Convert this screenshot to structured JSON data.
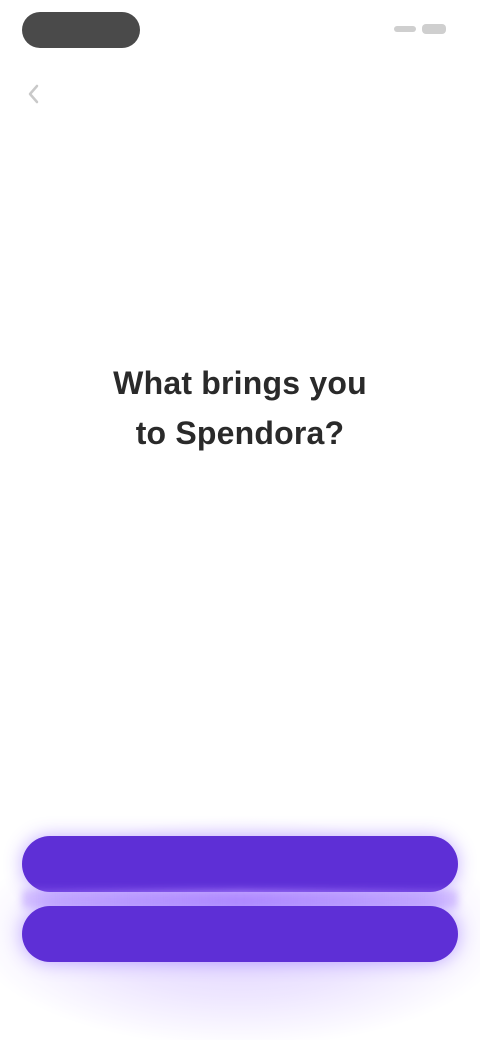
{
  "headline": {
    "line1": "What brings you",
    "line2": "to Spendora?"
  },
  "buttons": {
    "primary_label": "",
    "secondary_label": ""
  },
  "icons": {
    "back": "chevron-left-icon",
    "status": "status-icons"
  },
  "colors": {
    "background": "#ffffff",
    "button": "#5e2fd6",
    "glow": "#a178ff",
    "headline": "#2a2a2a"
  }
}
